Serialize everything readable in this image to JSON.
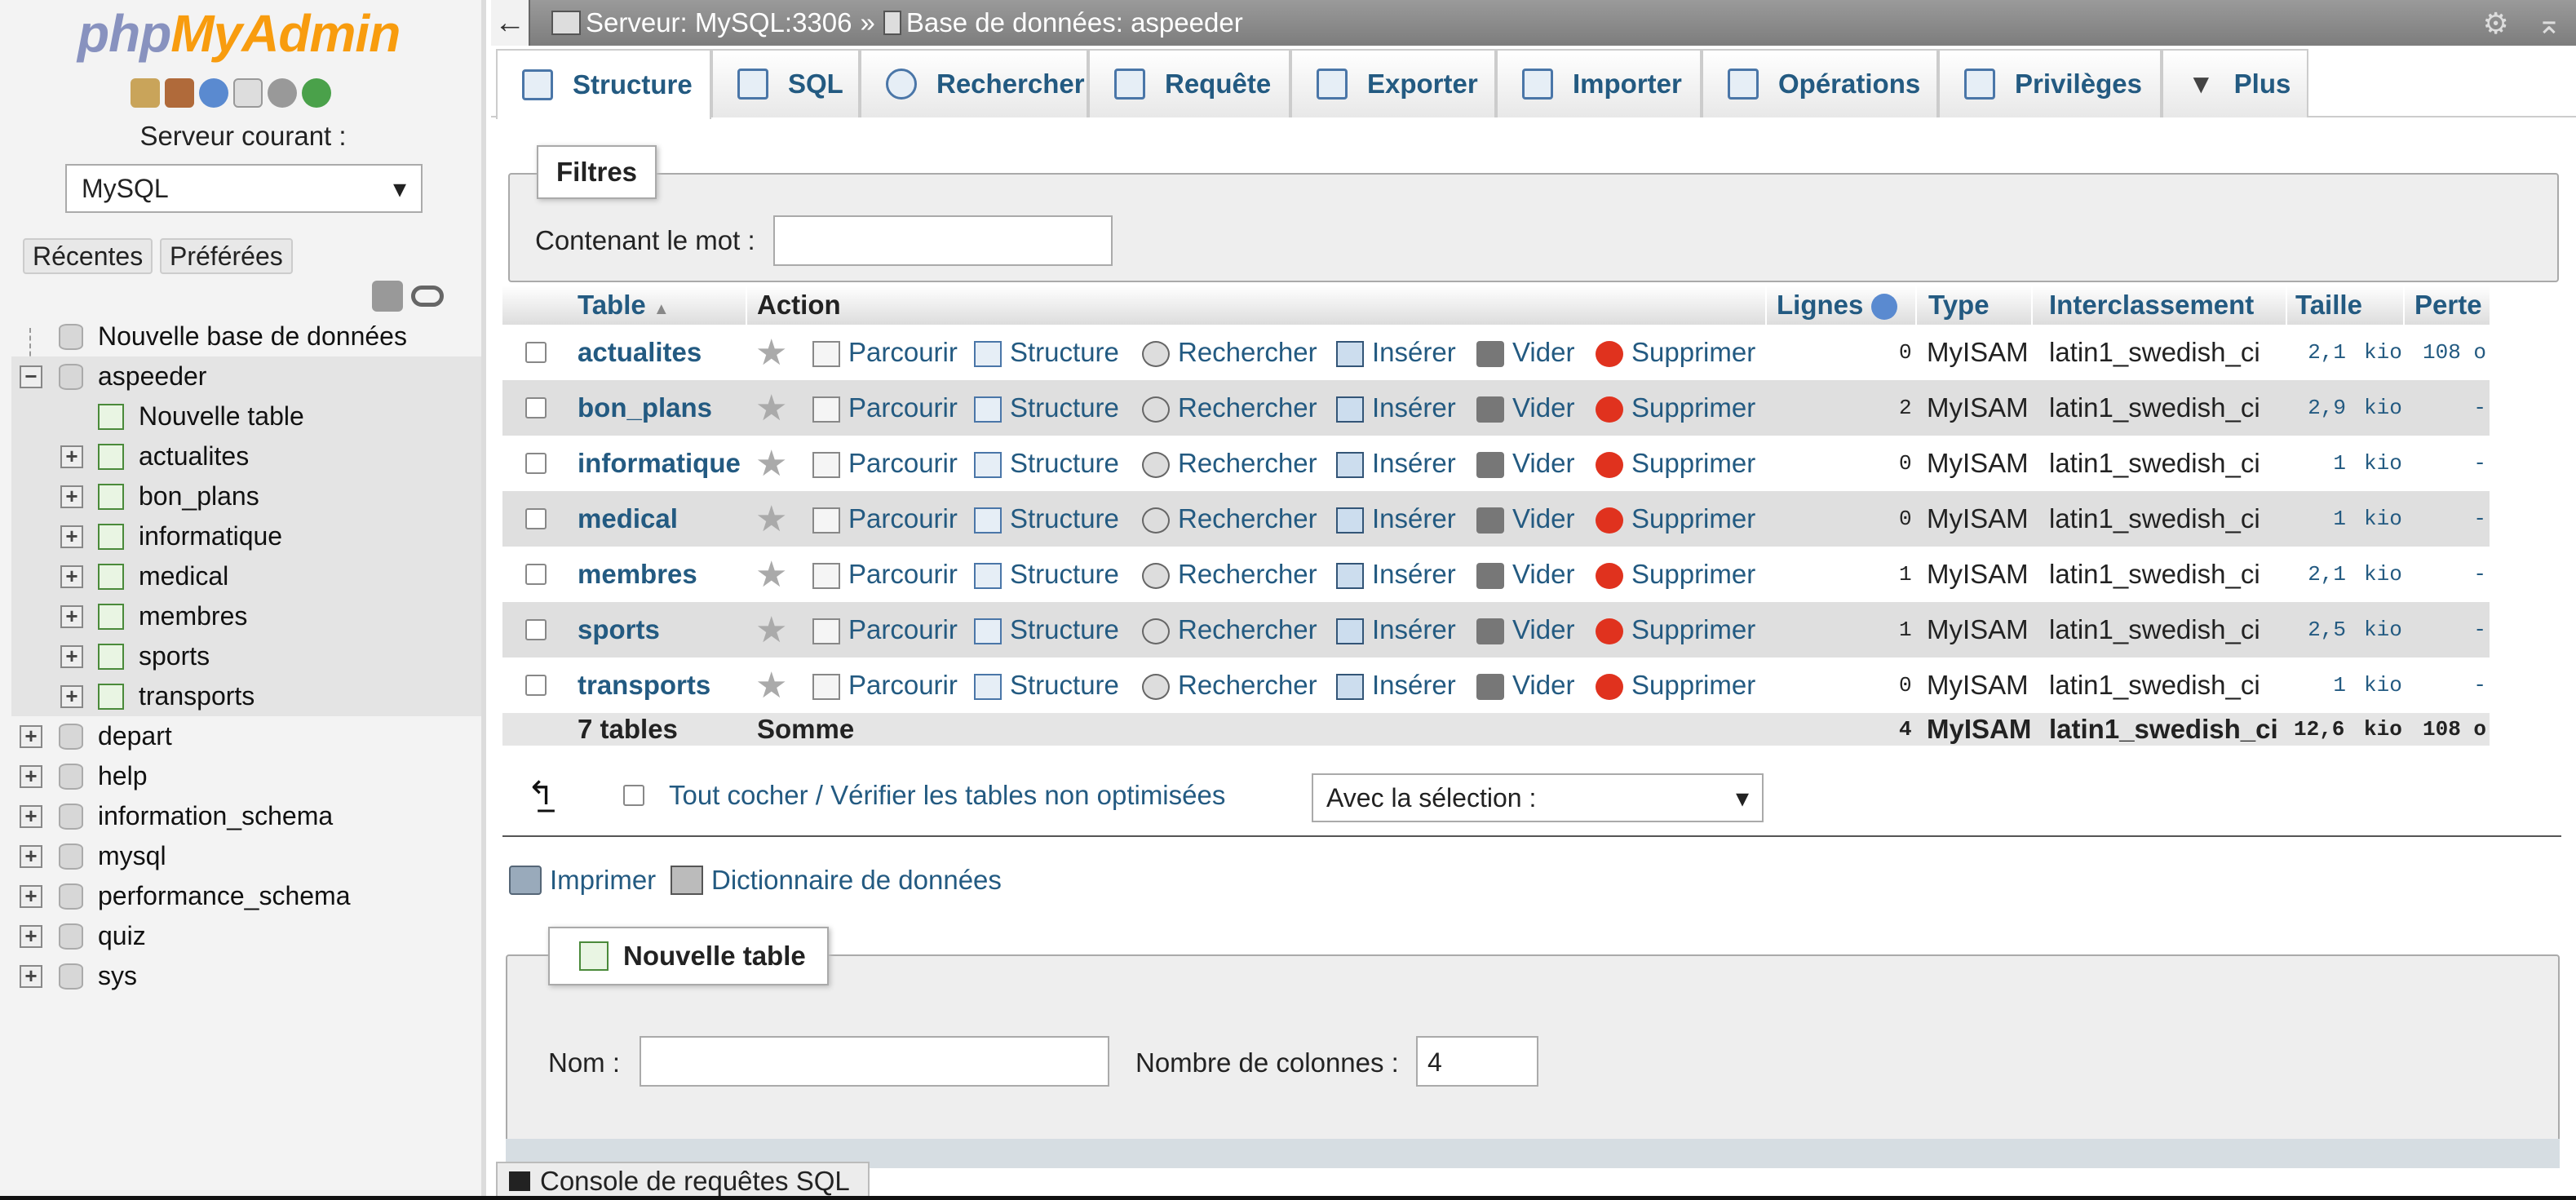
{
  "nav": {
    "logo_php": "php",
    "logo_admin": "MyAdmin",
    "server_label": "Serveur courant :",
    "server_value": "MySQL",
    "recent_label": "Récentes",
    "favorites_label": "Préférées",
    "icons": [
      "home-icon",
      "exit-icon",
      "help-icon",
      "docs-icon",
      "settings-icon",
      "reload-icon"
    ],
    "tree": {
      "new_db": "Nouvelle base de données",
      "current_db": "aspeeder",
      "new_table": "Nouvelle table",
      "tables": [
        "actualites",
        "bon_plans",
        "informatique",
        "medical",
        "membres",
        "sports",
        "transports"
      ],
      "other_dbs": [
        "depart",
        "help",
        "information_schema",
        "mysql",
        "performance_schema",
        "quiz",
        "sys"
      ]
    }
  },
  "topbar": {
    "server_crumb": "Serveur: MySQL:3306",
    "separator": "»",
    "db_crumb": "Base de données: aspeeder"
  },
  "tabs": [
    {
      "label": "Structure",
      "icon": "structure-icon",
      "active": true
    },
    {
      "label": "SQL",
      "icon": "sql-icon"
    },
    {
      "label": "Rechercher",
      "icon": "search-icon"
    },
    {
      "label": "Requête",
      "icon": "query-icon"
    },
    {
      "label": "Exporter",
      "icon": "export-icon"
    },
    {
      "label": "Importer",
      "icon": "import-icon"
    },
    {
      "label": "Opérations",
      "icon": "wrench-icon"
    },
    {
      "label": "Privilèges",
      "icon": "privileges-icon"
    },
    {
      "label": "Plus",
      "icon": "chevron-down-icon"
    }
  ],
  "filters": {
    "legend": "Filtres",
    "label": "Contenant le mot :",
    "value": ""
  },
  "table": {
    "headers": {
      "table": "Table",
      "action": "Action",
      "rows": "Lignes",
      "type": "Type",
      "collation": "Interclassement",
      "size": "Taille",
      "overhead": "Perte"
    },
    "actions": {
      "browse": "Parcourir",
      "structure": "Structure",
      "search": "Rechercher",
      "insert": "Insérer",
      "empty": "Vider",
      "drop": "Supprimer"
    },
    "rows": [
      {
        "name": "actualites",
        "rows": "0",
        "type": "MyISAM",
        "collation": "latin1_swedish_ci",
        "size": "2,1",
        "unit": "kio",
        "overhead": "108 o"
      },
      {
        "name": "bon_plans",
        "rows": "2",
        "type": "MyISAM",
        "collation": "latin1_swedish_ci",
        "size": "2,9",
        "unit": "kio",
        "overhead": "-"
      },
      {
        "name": "informatique",
        "rows": "0",
        "type": "MyISAM",
        "collation": "latin1_swedish_ci",
        "size": "1",
        "unit": "kio",
        "overhead": "-"
      },
      {
        "name": "medical",
        "rows": "0",
        "type": "MyISAM",
        "collation": "latin1_swedish_ci",
        "size": "1",
        "unit": "kio",
        "overhead": "-"
      },
      {
        "name": "membres",
        "rows": "1",
        "type": "MyISAM",
        "collation": "latin1_swedish_ci",
        "size": "2,1",
        "unit": "kio",
        "overhead": "-"
      },
      {
        "name": "sports",
        "rows": "1",
        "type": "MyISAM",
        "collation": "latin1_swedish_ci",
        "size": "2,5",
        "unit": "kio",
        "overhead": "-"
      },
      {
        "name": "transports",
        "rows": "0",
        "type": "MyISAM",
        "collation": "latin1_swedish_ci",
        "size": "1",
        "unit": "kio",
        "overhead": "-"
      }
    ],
    "footer": {
      "count": "7 tables",
      "sum": "Somme",
      "rows": "4",
      "type": "MyISAM",
      "collation": "latin1_swedish_ci",
      "size": "12,6",
      "unit": "kio",
      "overhead": "108 o"
    }
  },
  "bulk": {
    "check_all": "Tout cocher",
    "slash": "/",
    "check_overhead": "Vérifier les tables non optimisées",
    "with_selection": "Avec la sélection :"
  },
  "links": {
    "print": "Imprimer",
    "dictionary": "Dictionnaire de données"
  },
  "new_table": {
    "legend": "Nouvelle table",
    "name_label": "Nom :",
    "name_value": "",
    "cols_label": "Nombre de colonnes :",
    "cols_value": "4"
  },
  "console": {
    "label": "Console de requêtes SQL"
  },
  "colors": {
    "link": "#235a81",
    "logo_php": "#8892bf",
    "logo_admin": "#f89c0e",
    "drop": "#e0321e"
  }
}
